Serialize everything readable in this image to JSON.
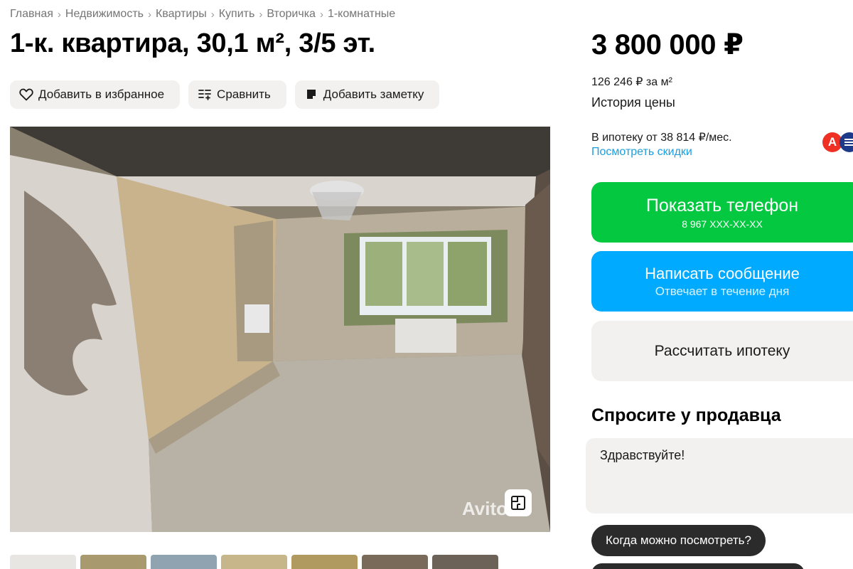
{
  "breadcrumbs": [
    "Главная",
    "Недвижимость",
    "Квартиры",
    "Купить",
    "Вторичка",
    "1-комнатные"
  ],
  "breadcrumb_separator": "›",
  "title": "1-к. квартира, 30,1 м², 3/5 эт.",
  "actions": {
    "favorite": "Добавить в избранное",
    "compare": "Сравнить",
    "note": "Добавить заметку"
  },
  "photo": {
    "watermark": "Avito"
  },
  "price": "3 800 000 ₽",
  "price_per_m2": "126 246 ₽ за м²",
  "price_history": "История цены",
  "mortgage": {
    "text": "В ипотеку от 38 814 ₽/мес.",
    "discounts_link": "Посмотреть скидки",
    "bank_a_letter": "А"
  },
  "buttons": {
    "phone_label": "Показать телефон",
    "phone_number": "8 967 XXX-XX-XX",
    "message_label": "Написать сообщение",
    "message_sub": "Отвечает в течение дня",
    "mortgage_calc": "Рассчитать ипотеку"
  },
  "ask_seller": {
    "title": "Спросите у продавца",
    "message_value": "Здравствуйте!",
    "quick_question": "Когда можно посмотреть?"
  },
  "colors": {
    "green": "#04c940",
    "blue": "#00aaff",
    "link": "#1a9ee0",
    "chip": "#2b2b2b",
    "soft_bg": "#f2f1f0"
  },
  "icons": {
    "favorite": "heart-icon",
    "compare": "compare-icon",
    "note": "note-icon",
    "plan": "floor-plan-icon"
  }
}
